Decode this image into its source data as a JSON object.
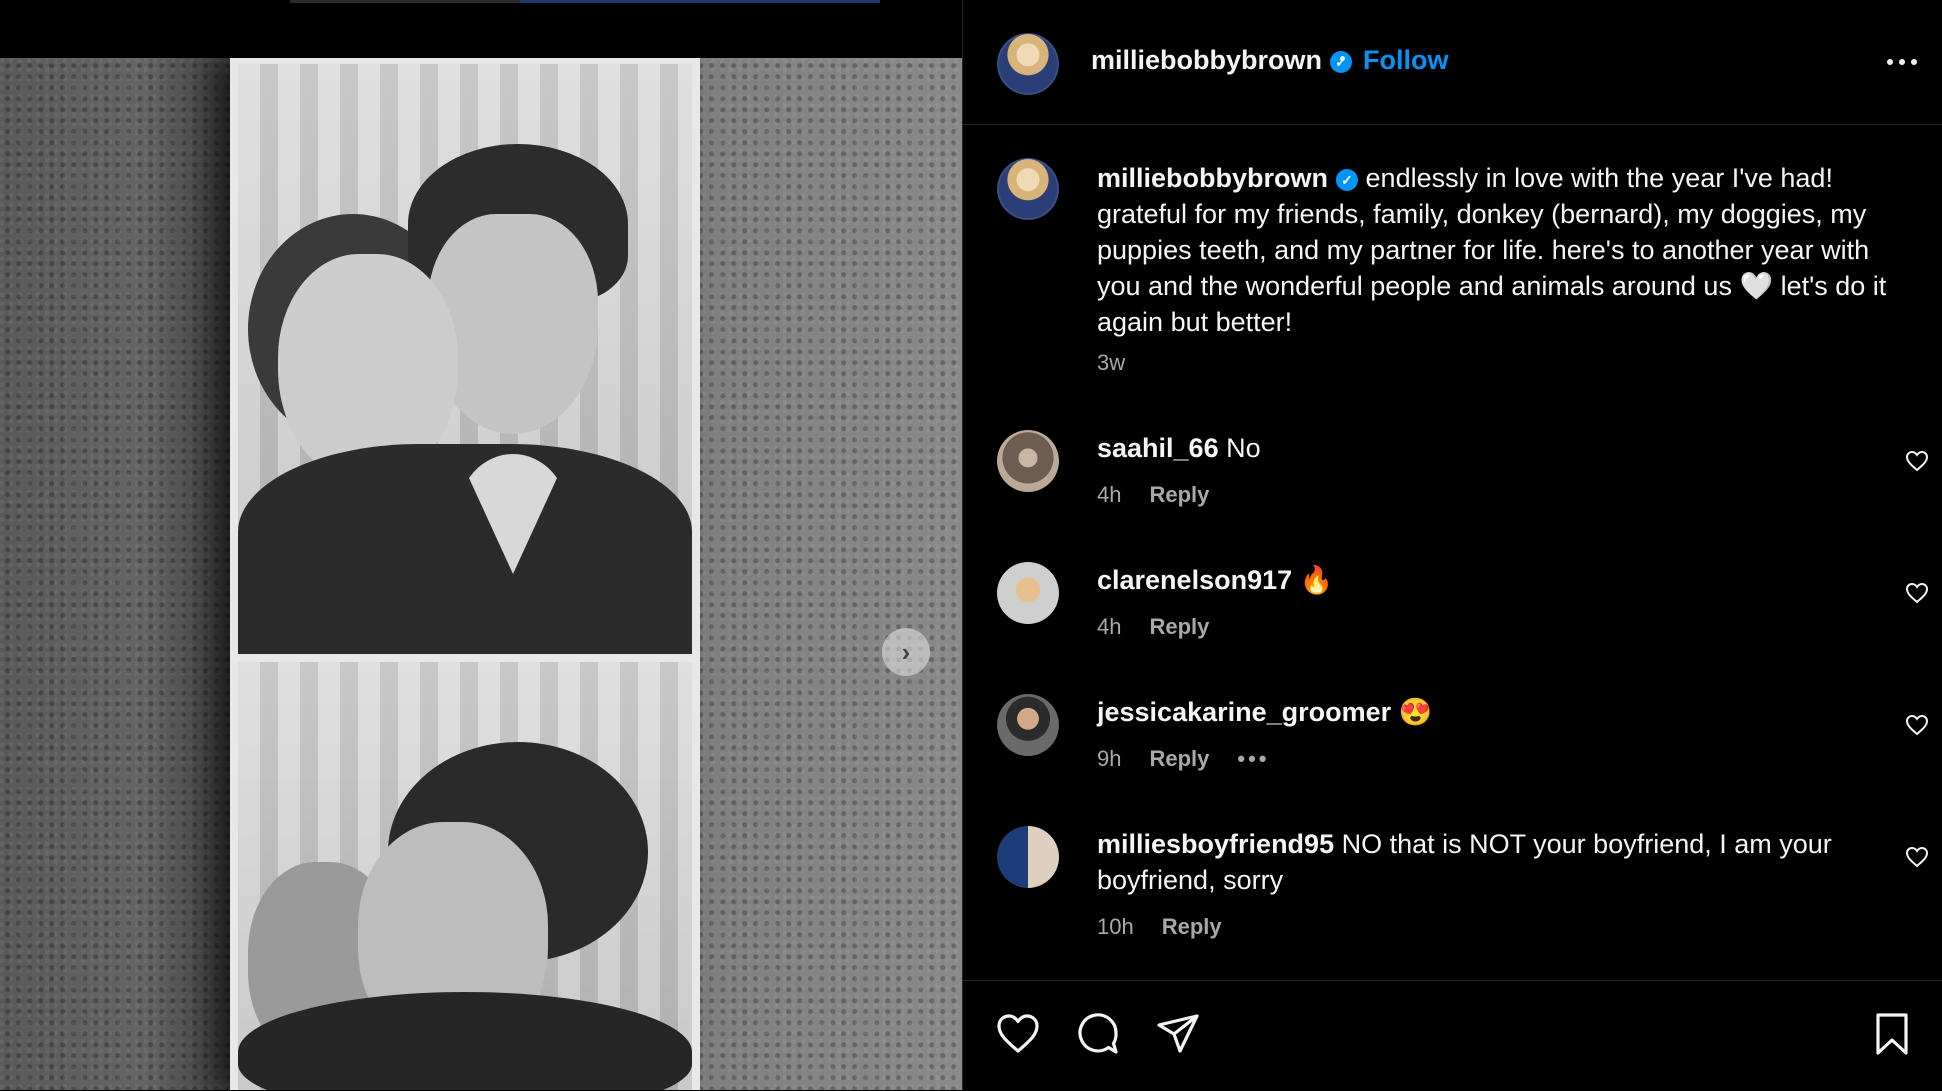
{
  "post": {
    "username": "milliebobbybrown",
    "verified_glyph": "✓",
    "separator": "•",
    "follow_label": "Follow",
    "caption": "endlessly in love with the year I've had! grateful for my friends, family, donkey (bernard), my doggies, my puppies teeth, and my partner for life. here's to another year with you and the wonderful people and animals around us 🤍 let's do it again but better!",
    "caption_time": "3w"
  },
  "carousel": {
    "next_glyph": "›"
  },
  "comments": [
    {
      "username": "saahil_66",
      "text": "No",
      "time": "4h",
      "reply_label": "Reply"
    },
    {
      "username": "clarenelson917",
      "text": "🔥",
      "time": "4h",
      "reply_label": "Reply"
    },
    {
      "username": "jessicakarine_groomer",
      "text": "😍",
      "time": "9h",
      "reply_label": "Reply",
      "more": "•••"
    },
    {
      "username": "milliesboyfriend95",
      "text": "NO that is NOT your boyfriend, I am your boyfriend, sorry",
      "time": "10h",
      "reply_label": "Reply"
    }
  ],
  "icons": {
    "options": "more-options-icon",
    "like": "heart-icon",
    "comment": "comment-icon",
    "share": "send-icon",
    "save": "bookmark-icon"
  },
  "colors": {
    "accent": "#0095f6",
    "background": "#000000",
    "muted": "#a8a8a8"
  }
}
